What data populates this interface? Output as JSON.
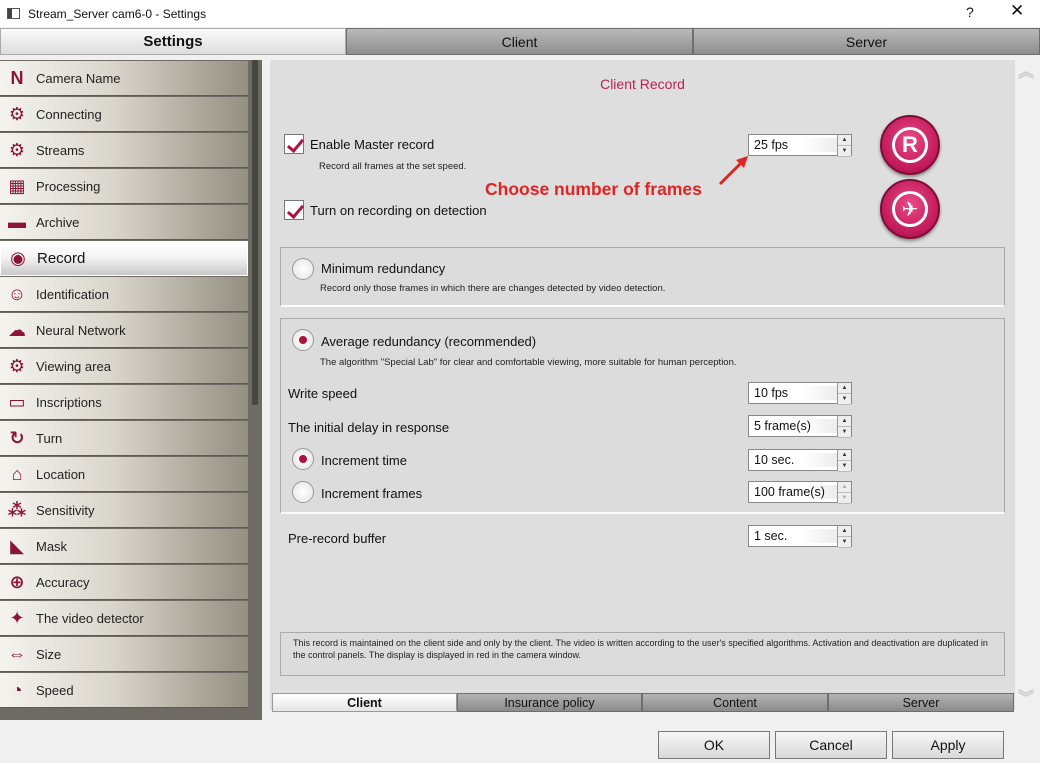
{
  "window": {
    "title": "Stream_Server cam6-0 - Settings",
    "help": "?",
    "close": "✕"
  },
  "top_tabs": [
    {
      "label": "Settings",
      "active": true
    },
    {
      "label": "Client",
      "active": false
    },
    {
      "label": "Server",
      "active": false
    }
  ],
  "sidebar": {
    "items": [
      {
        "label": "Camera Name",
        "icon": "letter-n-icon",
        "glyph": "N"
      },
      {
        "label": "Connecting",
        "icon": "gear-icon",
        "glyph": "⚙"
      },
      {
        "label": "Streams",
        "icon": "gear-icon",
        "glyph": "⚙"
      },
      {
        "label": "Processing",
        "icon": "monitor-icon",
        "glyph": "▦"
      },
      {
        "label": "Archive",
        "icon": "folder-icon",
        "glyph": "▬"
      },
      {
        "label": "Record",
        "icon": "record-icon",
        "glyph": "◉",
        "active": true
      },
      {
        "label": "Identification",
        "icon": "face-icon",
        "glyph": "☺"
      },
      {
        "label": "Neural Network",
        "icon": "brain-icon",
        "glyph": "☁"
      },
      {
        "label": "Viewing area",
        "icon": "gear-icon",
        "glyph": "⚙"
      },
      {
        "label": "Inscriptions",
        "icon": "caption-icon",
        "glyph": "▭"
      },
      {
        "label": "Turn",
        "icon": "rotate-icon",
        "glyph": "↻"
      },
      {
        "label": "Location",
        "icon": "house-icon",
        "glyph": "⌂"
      },
      {
        "label": "Sensitivity",
        "icon": "sensitivity-icon",
        "glyph": "⁂"
      },
      {
        "label": "Mask",
        "icon": "mask-icon",
        "glyph": "◣"
      },
      {
        "label": "Accuracy",
        "icon": "target-icon",
        "glyph": "⊕"
      },
      {
        "label": "The video detector",
        "icon": "walker-icon",
        "glyph": "✦"
      },
      {
        "label": "Size",
        "icon": "size-icon",
        "glyph": "⇔"
      },
      {
        "label": "Speed",
        "icon": "speedometer-icon",
        "glyph": "◔"
      }
    ]
  },
  "main": {
    "section_title": "Client Record",
    "enable_master": {
      "label": "Enable Master record",
      "desc": "Record all frames at the set speed.",
      "checked": true,
      "fps": "25 fps"
    },
    "annotation": "Choose number of frames",
    "detection": {
      "label": "Turn on recording on detection",
      "checked": true
    },
    "min_redundancy": {
      "label": "Minimum redundancy",
      "desc": "Record only those frames in which there are changes detected by video detection."
    },
    "avg_redundancy": {
      "label": "Average redundancy (recommended)",
      "desc": "The algorithm \"Special Lab\" for clear and comfortable viewing, more suitable for human perception."
    },
    "write_speed": {
      "label": "Write speed",
      "value": "10 fps"
    },
    "initial_delay": {
      "label": "The initial delay in response",
      "value": "5 frame(s)"
    },
    "increment_time": {
      "label": "Increment time",
      "value": "10 sec."
    },
    "increment_frames": {
      "label": "Increment frames",
      "value": "100 frame(s)"
    },
    "pre_record": {
      "label": "Pre-record buffer",
      "value": "1 sec."
    },
    "note": "This record is maintained on the client side and only by the client. The video is written according to the user's specified algorithms. Activation and deactivation are duplicated in the control panels. The display is displayed in red in the camera window."
  },
  "bottom_tabs": [
    {
      "label": "Client",
      "active": true
    },
    {
      "label": "Insurance policy",
      "active": false
    },
    {
      "label": "Content",
      "active": false
    },
    {
      "label": "Server",
      "active": false
    }
  ],
  "buttons": {
    "ok": "OK",
    "cancel": "Cancel",
    "apply": "Apply"
  },
  "colors": {
    "accent": "#b0103b",
    "annotation": "#e02424",
    "title": "#b4274d"
  }
}
